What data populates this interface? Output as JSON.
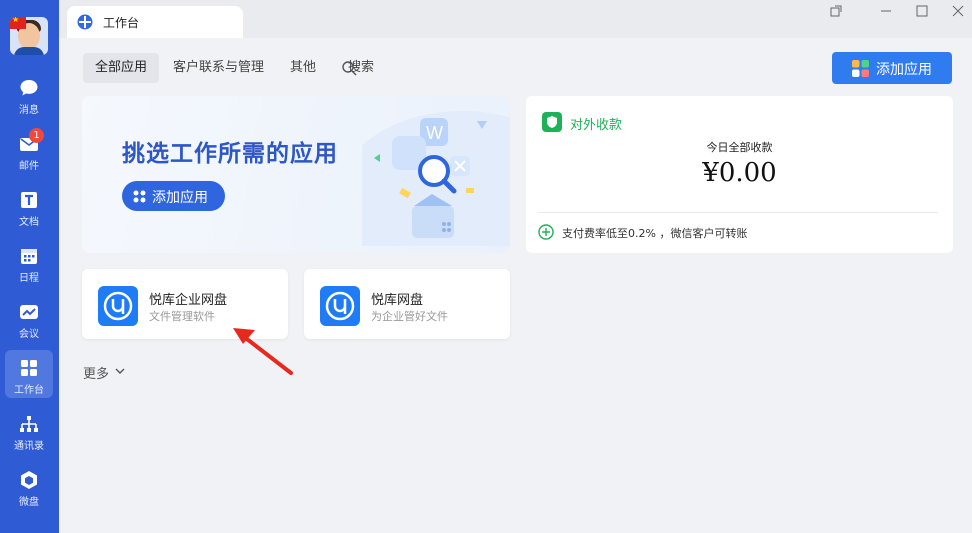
{
  "sidebar": {
    "items": [
      {
        "label": "消息",
        "icon": "chat-icon"
      },
      {
        "label": "邮件",
        "icon": "mail-icon",
        "badge": "1"
      },
      {
        "label": "文档",
        "icon": "doc-icon"
      },
      {
        "label": "日程",
        "icon": "calendar-icon"
      },
      {
        "label": "会议",
        "icon": "meeting-icon"
      },
      {
        "label": "工作台",
        "icon": "workbench-icon",
        "active": true
      },
      {
        "label": "通讯录",
        "icon": "contacts-icon"
      },
      {
        "label": "微盘",
        "icon": "drive-icon"
      }
    ]
  },
  "window": {
    "tab_title": "工作台"
  },
  "filters": {
    "all": "全部应用",
    "customer": "客户联系与管理",
    "other": "其他",
    "search": "搜索"
  },
  "toolbar": {
    "add_app": "添加应用"
  },
  "banner": {
    "title": "挑选工作所需的应用",
    "button": "添加应用"
  },
  "payment": {
    "title": "对外收款",
    "subtitle": "今日全部收款",
    "amount": "¥0.00",
    "note": "支付费率低至0.2% ，微信客户可转账"
  },
  "apps": [
    {
      "name": "悦库企业网盘",
      "desc": "文件管理软件"
    },
    {
      "name": "悦库网盘",
      "desc": "为企业管好文件"
    }
  ],
  "more": "更多",
  "colors": {
    "sidebar": "#2f5bd4",
    "accent": "#2f7bf0",
    "pay_green": "#1fb15a",
    "arrow_red": "#e8271d"
  }
}
